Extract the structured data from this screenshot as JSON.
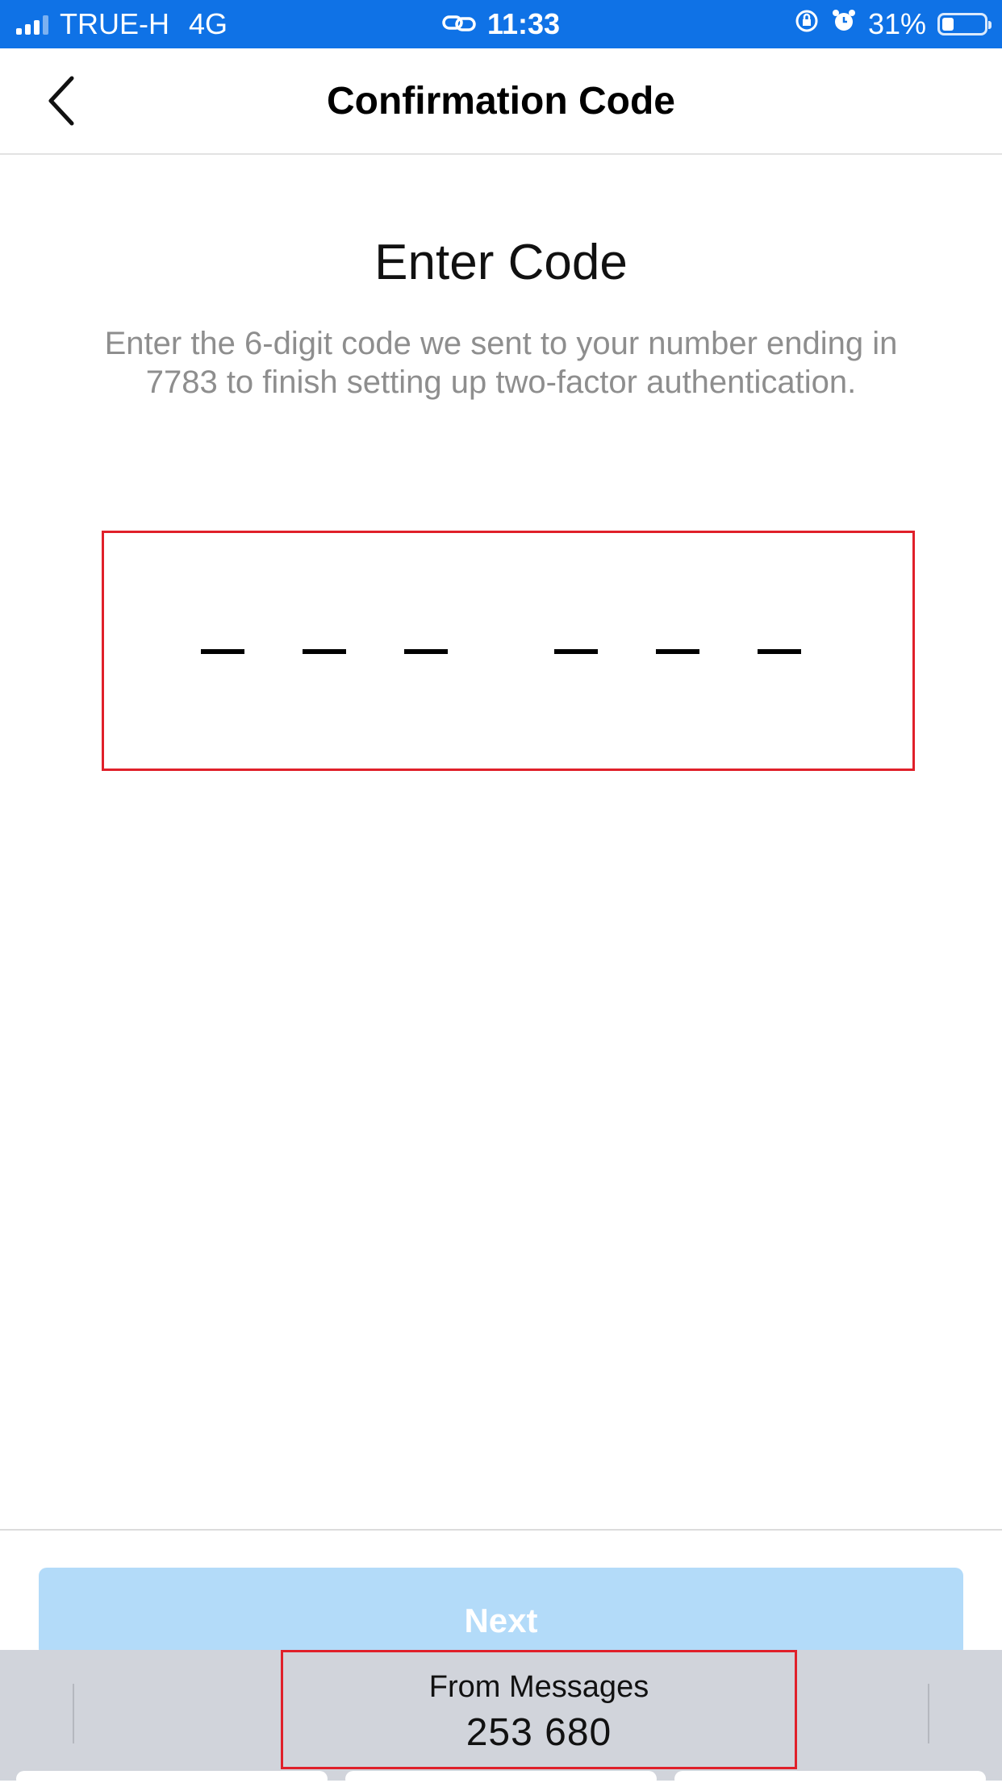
{
  "status_bar": {
    "carrier": "TRUE-H",
    "network": "4G",
    "time": "11:33",
    "battery": "31%",
    "battery_level": 0.31,
    "icons": [
      "signal-icon",
      "link-icon",
      "rotation-lock-icon",
      "alarm-icon",
      "battery-icon"
    ]
  },
  "nav": {
    "title": "Confirmation Code",
    "back_icon": "chevron-left-icon"
  },
  "content": {
    "heading": "Enter Code",
    "description_line1": "Enter the 6-digit code we sent to your number ending in",
    "description_line2": "7783 to finish setting up two-factor authentication."
  },
  "code_input": {
    "digits": [
      "",
      "",
      "",
      "",
      "",
      ""
    ]
  },
  "footer": {
    "next_label": "Next"
  },
  "keyboard_suggestion": {
    "label": "From Messages",
    "code": "253 680"
  },
  "colors": {
    "status_bar": "#0f72e6",
    "next_button_disabled": "#b3dbf9",
    "highlight_border": "#e0202a",
    "secondary_text": "#8e8e8e",
    "keyboard_bg": "#d1d4db"
  }
}
